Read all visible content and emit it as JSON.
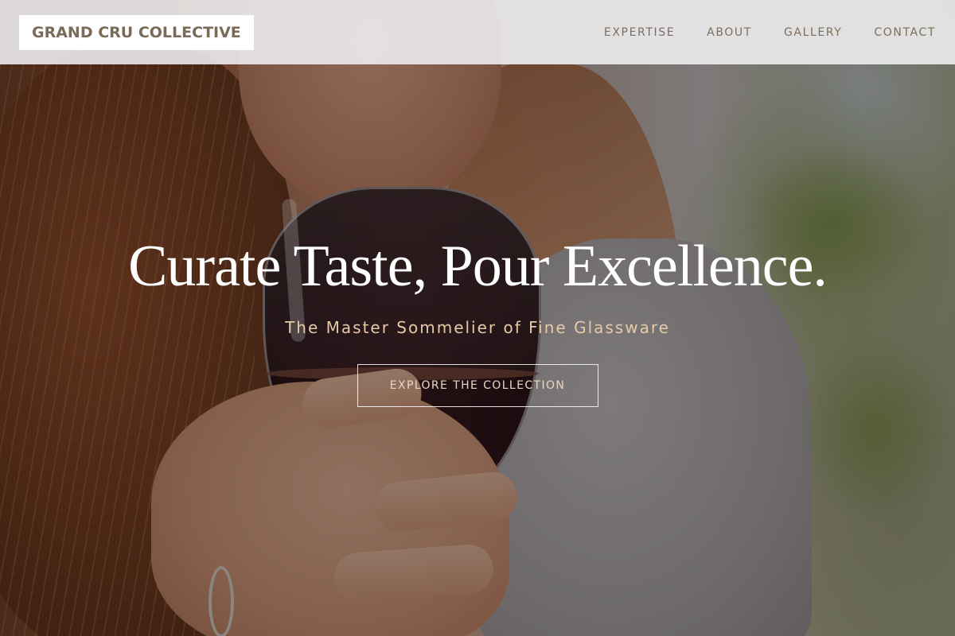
{
  "navbar": {
    "logo": "GRAND CRU COLLECTIVE",
    "links": [
      "EXPERTISE",
      "ABOUT",
      "GALLERY",
      "CONTACT"
    ]
  },
  "hero": {
    "headline": "Curate Taste, Pour Excellence.",
    "subheadline": "The Master Sommelier of Fine Glassware",
    "cta_label": "EXPLORE THE COLLECTION",
    "background_photo": "woman sipping red wine from a glass"
  },
  "colors": {
    "logo_text": "#7a6a58",
    "nav_text": "#7d6d5c",
    "headline": "#ffffff",
    "subheadline": "#e6c9a6",
    "cta_text": "#e6d7c4"
  }
}
